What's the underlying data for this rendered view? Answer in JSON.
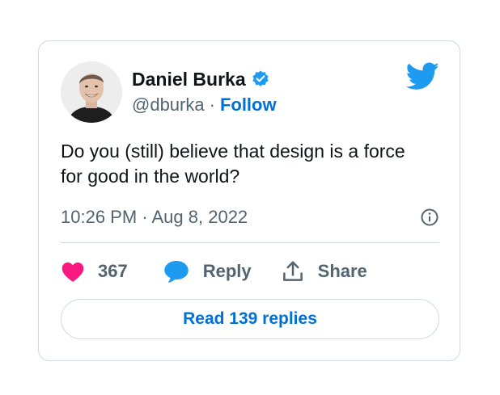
{
  "author": {
    "name": "Daniel Burka",
    "handle": "@dburka",
    "separator": "·",
    "follow_label": "Follow"
  },
  "tweet": {
    "text": "Do you (still) believe that design is a force\nfor good in the world?",
    "timestamp": "10:26 PM · Aug 8, 2022"
  },
  "actions": {
    "like_count": "367",
    "reply_label": "Reply",
    "share_label": "Share"
  },
  "read_replies_label": "Read 139 replies",
  "icons": {
    "verified": "verified-badge-icon",
    "brand": "twitter-bird-icon",
    "info": "info-icon",
    "like": "heart-icon",
    "reply": "speech-bubble-icon",
    "share": "share-upload-icon"
  },
  "colors": {
    "brand_blue": "#1d9bf0",
    "link_blue": "#006fd6",
    "like_pink": "#f91880",
    "text_primary": "#0f1419",
    "text_secondary": "#536471",
    "border": "#cfd9de"
  }
}
